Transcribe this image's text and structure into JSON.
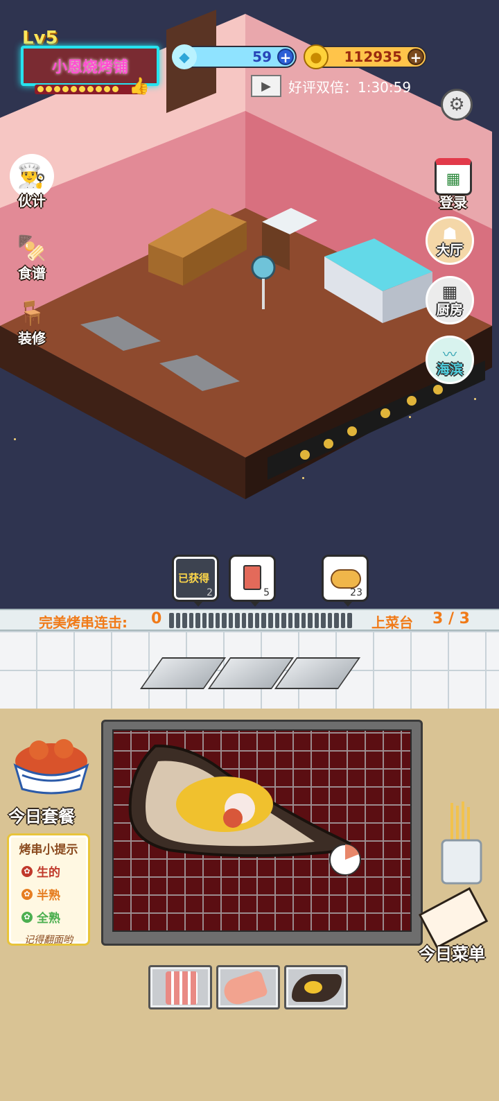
{
  "header": {
    "level": "Lv5",
    "shop_name": "小恩烧烤铺",
    "gems": "59",
    "coins": "112935",
    "bonus_text": "好评双倍：1:30:59"
  },
  "left_menu": [
    {
      "label": "伙计",
      "icon": "chef-icon"
    },
    {
      "label": "食谱",
      "icon": "skewer-icon"
    },
    {
      "label": "装修",
      "icon": "table-icon"
    }
  ],
  "right_menu": {
    "login": "登录",
    "hall": "大厅",
    "kitchen": "厨房",
    "beach": "海滨"
  },
  "bubbles": [
    {
      "label": "已获得",
      "count": "2"
    },
    {
      "label": "",
      "count": "5"
    },
    {
      "label": "",
      "count": "23"
    }
  ],
  "combo": {
    "label": "完美烤串连击:",
    "value": "0",
    "counter_label": "上菜台",
    "counter_value": "3 / 3"
  },
  "today_meal": "今日套餐",
  "today_menu": "今日菜单",
  "tips": {
    "title": "烤串小提示",
    "raw": "生的",
    "medium": "半熟",
    "done": "全熟",
    "note": "记得翻面哟"
  },
  "colors": {
    "raw": "#c0392b",
    "medium": "#e67e22",
    "done": "#4caf50",
    "accent_orange": "#f07a18"
  }
}
